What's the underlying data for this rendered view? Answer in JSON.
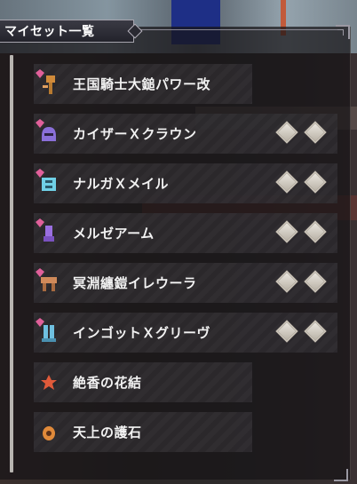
{
  "header": {
    "title": "マイセット一覧"
  },
  "items": [
    {
      "name": "王国騎士大鎚パワー改",
      "icon": "hammer-icon",
      "icon_color": "#d08a3a",
      "slots": 0
    },
    {
      "name": "カイザーＸクラウン",
      "icon": "helm-icon",
      "icon_color": "#8a6fd8",
      "slots": 2
    },
    {
      "name": "ナルガＸメイル",
      "icon": "chest-armor-icon",
      "icon_color": "#6fd0e6",
      "slots": 2
    },
    {
      "name": "メルゼアーム",
      "icon": "arm-armor-icon",
      "icon_color": "#9a6fe0",
      "slots": 2
    },
    {
      "name": "冥淵纏鎧イレウーラ",
      "icon": "waist-armor-icon",
      "icon_color": "#d08a5a",
      "slots": 2
    },
    {
      "name": "インゴットＸグリーヴ",
      "icon": "leg-armor-icon",
      "icon_color": "#6fc0e0",
      "slots": 2
    },
    {
      "name": "絶香の花結",
      "icon": "charm-flower-icon",
      "icon_color": "#e05a3a",
      "slots": 0
    },
    {
      "name": "天上の護石",
      "icon": "talisman-icon",
      "icon_color": "#e08a3a",
      "slots": 0
    }
  ],
  "colors": {
    "gem_pink": "#e0609a",
    "slot_fill": "#e6e1d8"
  }
}
